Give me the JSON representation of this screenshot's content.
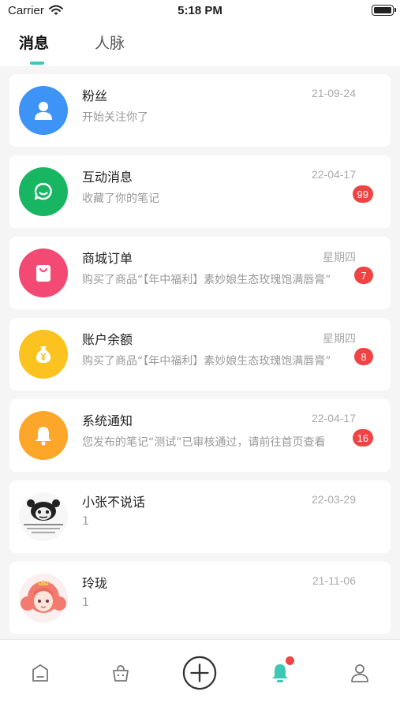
{
  "status_bar": {
    "carrier": "Carrier",
    "time": "5:18 PM"
  },
  "header": {
    "tabs": [
      {
        "label": "消息",
        "active": true
      },
      {
        "label": "人脉",
        "active": false
      }
    ]
  },
  "colors": {
    "accent": "#3cc8b4",
    "badge": "#f04444",
    "fans": "#3d94f6",
    "interaction": "#18b663",
    "orders": "#f24a72",
    "balance": "#fcc320",
    "notice": "#fca72a"
  },
  "messages": [
    {
      "title": "粉丝",
      "subtitle": "开始关注你了",
      "date": "21-09-24",
      "badge": "",
      "icon": "user-icon"
    },
    {
      "title": "互动消息",
      "subtitle": "收藏了你的笔记",
      "date": "22-04-17",
      "badge": "99",
      "icon": "chat-bubble-icon"
    },
    {
      "title": "商城订单",
      "subtitle": "购买了商品“【年中福利】素妙娘生态玫瑰饱满唇膏”",
      "date": "星期四",
      "badge": "7",
      "icon": "shopping-bag-icon"
    },
    {
      "title": "账户余额",
      "subtitle": "购买了商品“【年中福利】素妙娘生态玫瑰饱满唇膏”",
      "date": "星期四",
      "badge": "8",
      "icon": "money-bag-icon"
    },
    {
      "title": "系统通知",
      "subtitle": "您发布的笔记“测试”已审核通过，请前往首页查看",
      "date": "22-04-17",
      "badge": "16",
      "icon": "bell-icon"
    },
    {
      "title": "小张不说话",
      "subtitle": "1",
      "date": "22-03-29",
      "badge": "",
      "icon": "panda-meme-avatar"
    },
    {
      "title": "玲珑",
      "subtitle": "1",
      "date": "21-11-06",
      "badge": "",
      "icon": "anime-girl-avatar"
    }
  ],
  "tabbar": {
    "items": [
      {
        "icon": "home-icon"
      },
      {
        "icon": "shop-icon"
      },
      {
        "icon": "publish-plus-icon"
      },
      {
        "icon": "notification-bell-icon",
        "active": true
      },
      {
        "icon": "profile-icon"
      }
    ]
  }
}
